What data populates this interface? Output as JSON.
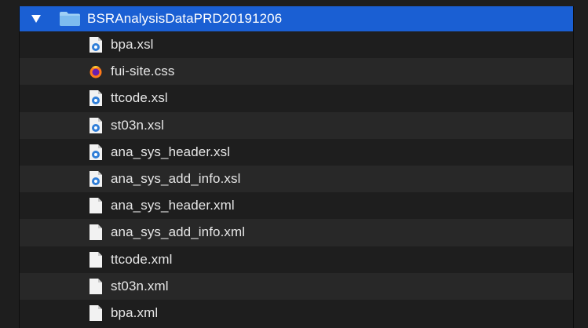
{
  "folder": {
    "name": "BSRAnalysisDataPRD20191206",
    "expanded": true,
    "icon": "folder-icon",
    "color": "#1a5fd3"
  },
  "files": [
    {
      "name": "bpa.xsl",
      "icon": "xsl-file-icon"
    },
    {
      "name": "fui-site.css",
      "icon": "css-file-icon"
    },
    {
      "name": "ttcode.xsl",
      "icon": "xsl-file-icon"
    },
    {
      "name": "st03n.xsl",
      "icon": "xsl-file-icon"
    },
    {
      "name": "ana_sys_header.xsl",
      "icon": "xsl-file-icon"
    },
    {
      "name": "ana_sys_add_info.xsl",
      "icon": "xsl-file-icon"
    },
    {
      "name": "ana_sys_header.xml",
      "icon": "xml-file-icon"
    },
    {
      "name": "ana_sys_add_info.xml",
      "icon": "xml-file-icon"
    },
    {
      "name": "ttcode.xml",
      "icon": "xml-file-icon"
    },
    {
      "name": "st03n.xml",
      "icon": "xml-file-icon"
    },
    {
      "name": "bpa.xml",
      "icon": "xml-file-icon"
    }
  ]
}
